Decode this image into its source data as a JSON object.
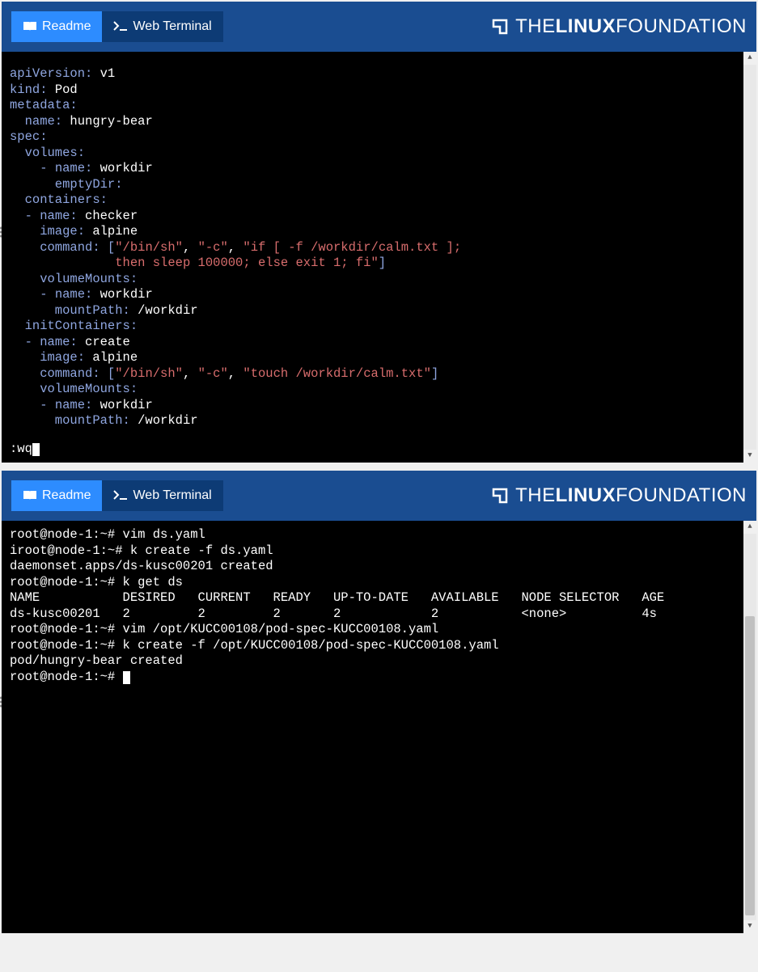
{
  "tabs": {
    "readme": "Readme",
    "terminal": "Web Terminal"
  },
  "brand": {
    "prefix": "THE",
    "bold": "LINUX",
    "suffix": "FOUNDATION"
  },
  "yaml": {
    "l1_k": "apiVersion:",
    "l1_v": " v1",
    "l2_k": "kind:",
    "l2_v": " Pod",
    "l3_k": "metadata:",
    "l4_k": "  name:",
    "l4_v": " hungry-bear",
    "l5_k": "spec:",
    "l6_k": "  volumes:",
    "l7_d": "    - ",
    "l7_k": "name:",
    "l7_v": " workdir",
    "l8_k": "      emptyDir:",
    "l9_k": "  containers:",
    "l10_d": "  - ",
    "l10_k": "name:",
    "l10_v": " checker",
    "l11_k": "    image:",
    "l11_v": " alpine",
    "l12_k": "    command:",
    "l12_b1": " [",
    "l12_s1": "\"/bin/sh\"",
    "l12_c1": ", ",
    "l12_s2": "\"-c\"",
    "l12_c2": ", ",
    "l12_s3": "\"if [ -f /workdir/calm.txt ];",
    "l13_pad": "              ",
    "l13_s": "then sleep 100000; else exit 1; fi\"",
    "l13_b2": "]",
    "l14_k": "    volumeMounts:",
    "l15_d": "    - ",
    "l15_k": "name:",
    "l15_v": " workdir",
    "l16_k": "      mountPath:",
    "l16_v": " /workdir",
    "l17_k": "  initContainers:",
    "l18_d": "  - ",
    "l18_k": "name:",
    "l18_v": " create",
    "l19_k": "    image:",
    "l19_v": " alpine",
    "l20_k": "    command:",
    "l20_b1": " [",
    "l20_s1": "\"/bin/sh\"",
    "l20_c1": ", ",
    "l20_s2": "\"-c\"",
    "l20_c2": ", ",
    "l20_s3": "\"touch /workdir/calm.txt\"",
    "l20_b2": "]",
    "l21_k": "    volumeMounts:",
    "l22_d": "    - ",
    "l22_k": "name:",
    "l22_v": " workdir",
    "l23_k": "      mountPath:",
    "l23_v": " /workdir",
    "vim_cmd": ":wq"
  },
  "shell": {
    "l1": "root@node-1:~# vim ds.yaml",
    "l2": "iroot@node-1:~# k create -f ds.yaml",
    "l3": "daemonset.apps/ds-kusc00201 created",
    "l4": "root@node-1:~# k get ds",
    "l5": "NAME           DESIRED   CURRENT   READY   UP-TO-DATE   AVAILABLE   NODE SELECTOR   AGE",
    "l6": "ds-kusc00201   2         2         2       2            2           <none>          4s",
    "l7": "root@node-1:~# vim /opt/KUCC00108/pod-spec-KUCC00108.yaml",
    "l8": "root@node-1:~# k create -f /opt/KUCC00108/pod-spec-KUCC00108.yaml",
    "l9": "pod/hungry-bear created",
    "l10": "root@node-1:~# "
  }
}
